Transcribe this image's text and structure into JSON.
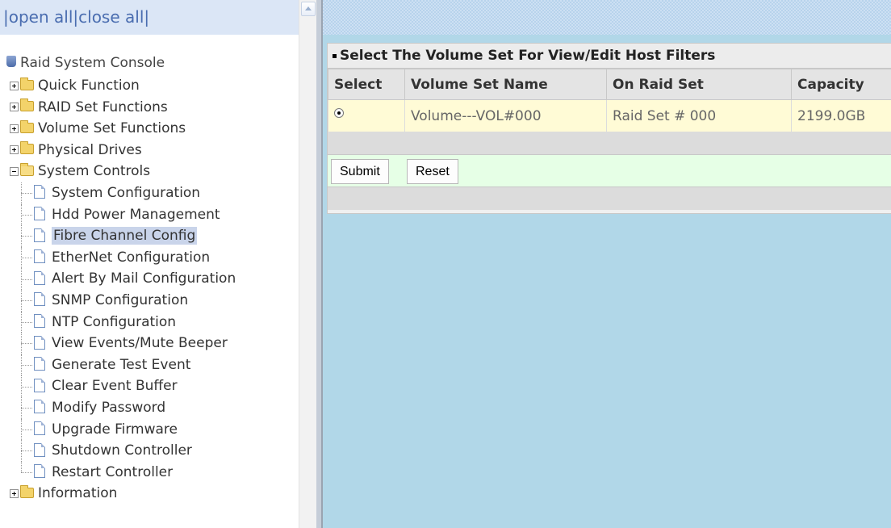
{
  "left": {
    "open_all": "open all",
    "close_all": "close all",
    "sep": "|",
    "root": "Raid System Console",
    "groups": [
      {
        "label": "Quick Function"
      },
      {
        "label": "RAID Set Functions"
      },
      {
        "label": "Volume Set Functions"
      },
      {
        "label": "Physical Drives"
      },
      {
        "label": "System Controls"
      }
    ],
    "system_controls_items": [
      {
        "label": "System Configuration"
      },
      {
        "label": "Hdd Power Management"
      },
      {
        "label": "Fibre Channel Config",
        "selected": true
      },
      {
        "label": "EtherNet Configuration"
      },
      {
        "label": "Alert By Mail Configuration"
      },
      {
        "label": "SNMP Configuration"
      },
      {
        "label": "NTP Configuration"
      },
      {
        "label": "View Events/Mute Beeper"
      },
      {
        "label": "Generate Test Event"
      },
      {
        "label": "Clear Event Buffer"
      },
      {
        "label": "Modify Password"
      },
      {
        "label": "Upgrade Firmware"
      },
      {
        "label": "Shutdown Controller"
      },
      {
        "label": "Restart Controller"
      }
    ],
    "information": "Information"
  },
  "main": {
    "title": "Select The Volume Set For View/Edit Host Filters",
    "columns": [
      "Select",
      "Volume Set Name",
      "On Raid Set",
      "Capacity"
    ],
    "rows": [
      {
        "selected": true,
        "name": "Volume---VOL#000",
        "raid_set": "Raid Set # 000",
        "capacity": "2199.0GB"
      }
    ],
    "submit": "Submit",
    "reset": "Reset"
  },
  "colors": {
    "content_bg": "#b1d7e8",
    "row_bg": "#fffbd6",
    "button_row_bg": "#e6ffe6",
    "selected_item_bg": "#c9d4ea"
  }
}
